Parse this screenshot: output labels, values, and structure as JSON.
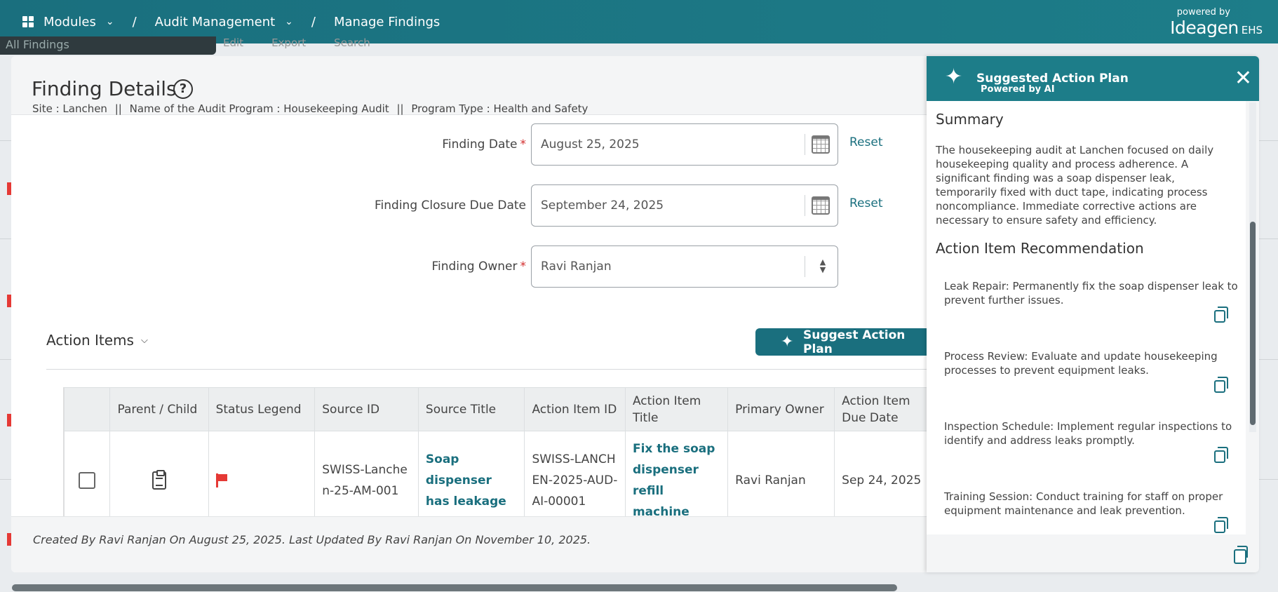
{
  "topbar": {
    "modules_label": "Modules",
    "audit_label": "Audit Management",
    "current_label": "Manage Findings",
    "sep": "/",
    "brand_powered": "powered by",
    "brand_name": "Ideagen",
    "brand_product": "EHS"
  },
  "background": {
    "tab_label": "All Findings",
    "edit_label": "Edit",
    "export_label": "Export",
    "search_label": "Search"
  },
  "finding": {
    "title": "Finding Details",
    "site": "Site : Lanchen",
    "sep": "||",
    "program": "Name of the Audit Program :  Housekeeping Audit",
    "type": "Program Type :  Health and Safety",
    "date_label": "Finding Date",
    "date_value": "August 25, 2025",
    "closure_label": "Finding Closure Due Date",
    "closure_value": "September 24, 2025",
    "owner_label": "Finding Owner",
    "owner_value": "Ravi Ranjan",
    "reset_label": "Reset",
    "required_mark": "*"
  },
  "action_items": {
    "title": "Action Items",
    "suggest_label": "Suggest Action Plan",
    "columns": [
      "Parent / Child",
      "Status Legend",
      "Source ID",
      "Source Title",
      "Action Item ID",
      "Action Item Title",
      "Primary Owner",
      "Action Item Due Date"
    ],
    "row": {
      "source_id": "SWISS-Lanchen-25-AM-001",
      "source_title": "Soap dispenser has leakage",
      "action_id": "SWISS-LANCHEN-2025-AUD-AI-00001",
      "action_title": "Fix the soap dispenser refill machine",
      "owner": "Ravi Ranjan",
      "due": "Sep 24, 2025"
    }
  },
  "footer": {
    "text": "Created By Ravi Ranjan On August 25, 2025. Last Updated By Ravi Ranjan On November 10, 2025."
  },
  "ai_panel": {
    "title": "Suggested Action Plan",
    "subtitle": "Powered by AI",
    "summary_heading": "Summary",
    "summary_text": "The housekeeping audit at Lanchen focused on daily housekeeping quality and process adherence. A significant finding was a soap dispenser leak, temporarily fixed with duct tape, indicating process noncompliance. Immediate corrective actions are necessary to ensure safety and efficiency.",
    "rec_heading": "Action Item Recommendation",
    "recommendations": [
      "Leak Repair: Permanently fix the soap dispenser leak to prevent further issues.",
      "Process Review: Evaluate and update housekeeping processes to prevent equipment leaks.",
      "Inspection Schedule: Implement regular inspections to identify and address leaks promptly.",
      "Training Session: Conduct training for staff on proper equipment maintenance and leak prevention."
    ]
  },
  "colors": {
    "brand": "#1a6f7e",
    "required": "#d32f2f",
    "flag": "#e53935"
  }
}
